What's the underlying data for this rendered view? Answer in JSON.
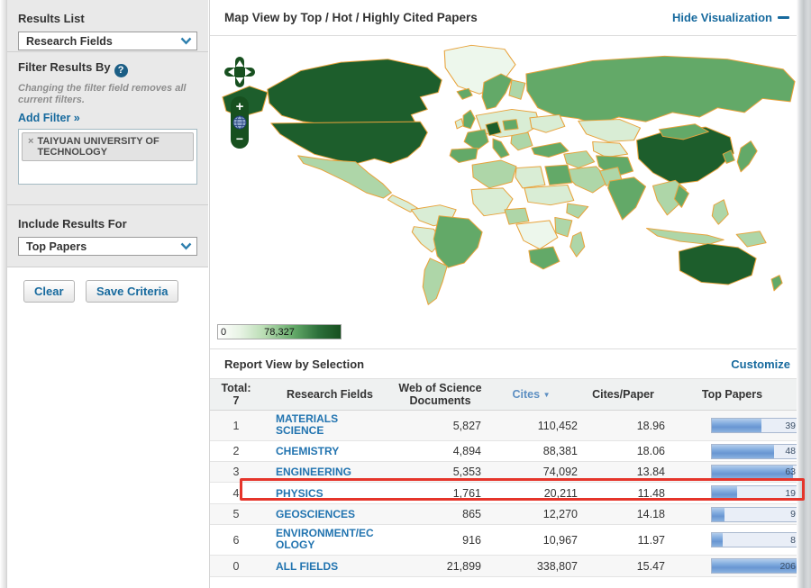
{
  "sidebar": {
    "results_list_label": "Results List",
    "results_list_value": "Research Fields",
    "filter_heading": "Filter Results By",
    "help_icon": "?",
    "filter_note": "Changing the filter field removes all current filters.",
    "add_filter_label": "Add Filter »",
    "filter_tag": "TAIYUAN UNIVERSITY OF TECHNOLOGY",
    "remove_icon": "×",
    "include_label": "Include Results For",
    "include_value": "Top Papers",
    "clear_button": "Clear",
    "save_button": "Save Criteria"
  },
  "map_panel": {
    "title": "Map View by Top / Hot / Highly Cited Papers",
    "hide_link": "Hide Visualization",
    "zoom_in": "+",
    "zoom_out": "−",
    "legend": {
      "min": "0",
      "max": "78,327"
    }
  },
  "report": {
    "title": "Report View by Selection",
    "customize_link": "Customize",
    "table": {
      "total_label": "Total:",
      "total_value": "7",
      "col_fields": "Research Fields",
      "col_docs": "Web of Science Documents",
      "col_cites": "Cites",
      "sort_icon": "▼",
      "col_cpp": "Cites/Paper",
      "col_top": "Top Papers",
      "rows": [
        {
          "rank": "1",
          "field": "MATERIALS SCIENCE",
          "docs": "5,827",
          "cites": "110,452",
          "cpp": "18.96",
          "top": "39",
          "pct": 59,
          "highlighted": false
        },
        {
          "rank": "2",
          "field": "CHEMISTRY",
          "docs": "4,894",
          "cites": "88,381",
          "cpp": "18.06",
          "top": "48",
          "pct": 73,
          "highlighted": false
        },
        {
          "rank": "3",
          "field": "ENGINEERING",
          "docs": "5,353",
          "cites": "74,092",
          "cpp": "13.84",
          "top": "63",
          "pct": 96,
          "highlighted": false
        },
        {
          "rank": "4",
          "field": "PHYSICS",
          "docs": "1,761",
          "cites": "20,211",
          "cpp": "11.48",
          "top": "19",
          "pct": 30,
          "highlighted": true
        },
        {
          "rank": "5",
          "field": "GEOSCIENCES",
          "docs": "865",
          "cites": "12,270",
          "cpp": "14.18",
          "top": "9",
          "pct": 15,
          "highlighted": false
        },
        {
          "rank": "6",
          "field": "ENVIRONMENT/ECOLOGY",
          "docs": "916",
          "cites": "10,967",
          "cpp": "11.97",
          "top": "8",
          "pct": 13,
          "highlighted": false
        },
        {
          "rank": "0",
          "field": "ALL FIELDS",
          "docs": "21,899",
          "cites": "338,807",
          "cpp": "15.47",
          "top": "206",
          "pct": 100,
          "highlighted": false
        }
      ]
    }
  },
  "map": {
    "palette": {
      "dark": "#1d5e2c",
      "medium": "#63a968",
      "light": "#aed6a8",
      "pale": "#d9edd5",
      "palest": "#edf7ec",
      "border": "#e8a33c"
    },
    "regions": {
      "greenland": "palest",
      "alaska": "dark",
      "canada": "dark",
      "usa": "dark",
      "mexico": "light",
      "central-america": "pale",
      "colombia-venezuela": "pale",
      "peru": "pale",
      "brazil": "medium",
      "argentina": "light",
      "iceland": "medium",
      "uk": "medium",
      "ireland": "pale",
      "norway-sweden": "medium",
      "finland": "light",
      "europe-east": "pale",
      "germany": "dark",
      "poland": "medium",
      "ukraine": "pale",
      "france": "medium",
      "spain": "medium",
      "italy": "medium",
      "balkans": "light",
      "turkey": "medium",
      "russia": "medium",
      "kazakhstan": "pale",
      "central-asia": "pale",
      "middle-east": "light",
      "saudi": "light",
      "iran": "medium",
      "north-africa": "light",
      "libya": "pale",
      "egypt": "medium",
      "west-africa": "pale",
      "nigeria": "light",
      "sudan-band": "pale",
      "ethiopia": "light",
      "central-africa": "palest",
      "east-africa": "light",
      "south-africa": "medium",
      "madagascar": "light",
      "pakistan": "light",
      "india": "medium",
      "china": "dark",
      "mongolia": "medium",
      "korea": "medium",
      "japan": "medium",
      "se-asia": "light",
      "vietnam": "medium",
      "philippines": "light",
      "indonesia": "light",
      "png": "light",
      "australia": "dark",
      "new-zealand": "medium"
    }
  }
}
